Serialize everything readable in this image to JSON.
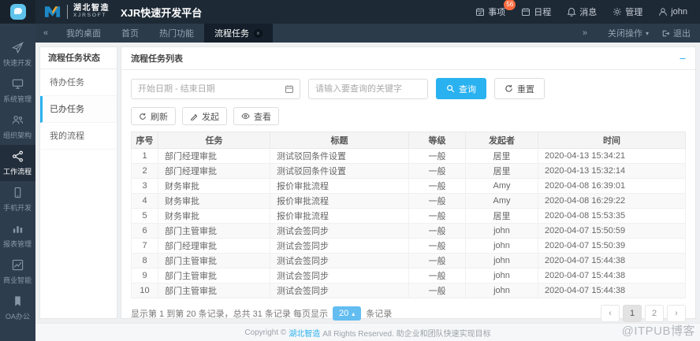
{
  "colors": {
    "accent": "#29b1f0",
    "badge": "#fb6b3f",
    "header_bg": "#1d2935",
    "sidebar_bg": "#2e3d4e",
    "tabbar_bg": "#2c3b4a",
    "page_size_bg": "#63bdf0"
  },
  "header": {
    "logo": {
      "brand": "湖北智造",
      "brand_sub": "XJRSOFT"
    },
    "title": "XJR快速开发平台",
    "items": [
      {
        "name": "matters",
        "label": "事项",
        "icon": "calendar-check-icon",
        "badge": "56"
      },
      {
        "name": "schedule",
        "label": "日程",
        "icon": "calendar-icon"
      },
      {
        "name": "messages",
        "label": "消息",
        "icon": "bell-icon"
      },
      {
        "name": "admin",
        "label": "管理",
        "icon": "gear-icon"
      },
      {
        "name": "user",
        "label": "john",
        "icon": "user-icon"
      }
    ]
  },
  "sidebar": {
    "items": [
      {
        "name": "quick-dev",
        "label": "快速开发",
        "icon": "paper-plane-icon",
        "active": false
      },
      {
        "name": "system-mgmt",
        "label": "系统管理",
        "icon": "monitor-icon",
        "active": false
      },
      {
        "name": "org-structure",
        "label": "组织架构",
        "icon": "organization-icon",
        "active": false
      },
      {
        "name": "workflow",
        "label": "工作流程",
        "icon": "share-icon",
        "active": true
      },
      {
        "name": "mobile-dev",
        "label": "手机开发",
        "icon": "mobile-icon",
        "active": false
      },
      {
        "name": "report-mgmt",
        "label": "报表管理",
        "icon": "bar-chart-icon",
        "active": false
      },
      {
        "name": "business-intel",
        "label": "商业智能",
        "icon": "line-chart-icon",
        "active": false
      },
      {
        "name": "oa-office",
        "label": "OA办公",
        "icon": "bookmark-icon",
        "active": false
      }
    ]
  },
  "tabbar": {
    "tabs": [
      {
        "name": "my-desktop",
        "label": "我的桌面",
        "active": false,
        "closable": false
      },
      {
        "name": "home",
        "label": "首页",
        "active": false,
        "closable": false
      },
      {
        "name": "hot-functions",
        "label": "热门功能",
        "active": false,
        "closable": false
      },
      {
        "name": "process-tasks",
        "label": "流程任务",
        "active": true,
        "closable": true
      }
    ],
    "close_ops_label": "关闭操作",
    "exit_label": "退出"
  },
  "task_panel": {
    "title": "流程任务状态",
    "items": [
      {
        "name": "todo",
        "label": "待办任务",
        "active": false
      },
      {
        "name": "done",
        "label": "已办任务",
        "active": true
      },
      {
        "name": "my-process",
        "label": "我的流程",
        "active": false
      }
    ]
  },
  "main": {
    "title": "流程任务列表",
    "search": {
      "date_placeholder": "开始日期 - 结束日期",
      "keyword_placeholder": "请输入要查询的关键字",
      "query_label": "查询",
      "reset_label": "重置"
    },
    "toolbar": {
      "refresh_label": "刷新",
      "launch_label": "发起",
      "view_label": "查看"
    },
    "table": {
      "columns": [
        "序号",
        "任务",
        "标题",
        "等级",
        "发起者",
        "时间"
      ],
      "rows": [
        [
          "1",
          "部门经理审批",
          "测试驳回条件设置",
          "一般",
          "居里",
          "2020-04-13 15:34:21"
        ],
        [
          "2",
          "部门经理审批",
          "测试驳回条件设置",
          "一般",
          "居里",
          "2020-04-13 15:32:14"
        ],
        [
          "3",
          "财务审批",
          "报价审批流程",
          "一般",
          "Amy",
          "2020-04-08 16:39:01"
        ],
        [
          "4",
          "财务审批",
          "报价审批流程",
          "一般",
          "Amy",
          "2020-04-08 16:29:22"
        ],
        [
          "5",
          "财务审批",
          "报价审批流程",
          "一般",
          "居里",
          "2020-04-08 15:53:35"
        ],
        [
          "6",
          "部门主管审批",
          "测试会签同步",
          "一般",
          "john",
          "2020-04-07 15:50:59"
        ],
        [
          "7",
          "部门经理审批",
          "测试会签同步",
          "一般",
          "john",
          "2020-04-07 15:50:39"
        ],
        [
          "8",
          "部门主管审批",
          "测试会签同步",
          "一般",
          "john",
          "2020-04-07 15:44:38"
        ],
        [
          "9",
          "部门主管审批",
          "测试会签同步",
          "一般",
          "john",
          "2020-04-07 15:44:38"
        ],
        [
          "10",
          "部门主管审批",
          "测试会签同步",
          "一般",
          "john",
          "2020-04-07 15:44:38"
        ]
      ]
    },
    "pagination": {
      "summary_prefix": "显示第 1 到第 20 条记录，总共 31 条记录 每页显示",
      "page_size": "20",
      "summary_suffix": "条记录",
      "pages": [
        "1",
        "2"
      ],
      "active_page": "1"
    }
  },
  "footer": {
    "copyright_prefix": "Copyright ©",
    "brand": "湖北智造",
    "copyright_suffix": "All Rights Reserved. 助企业和团队快速实现目标",
    "watermark": "@ITPUB博客"
  }
}
